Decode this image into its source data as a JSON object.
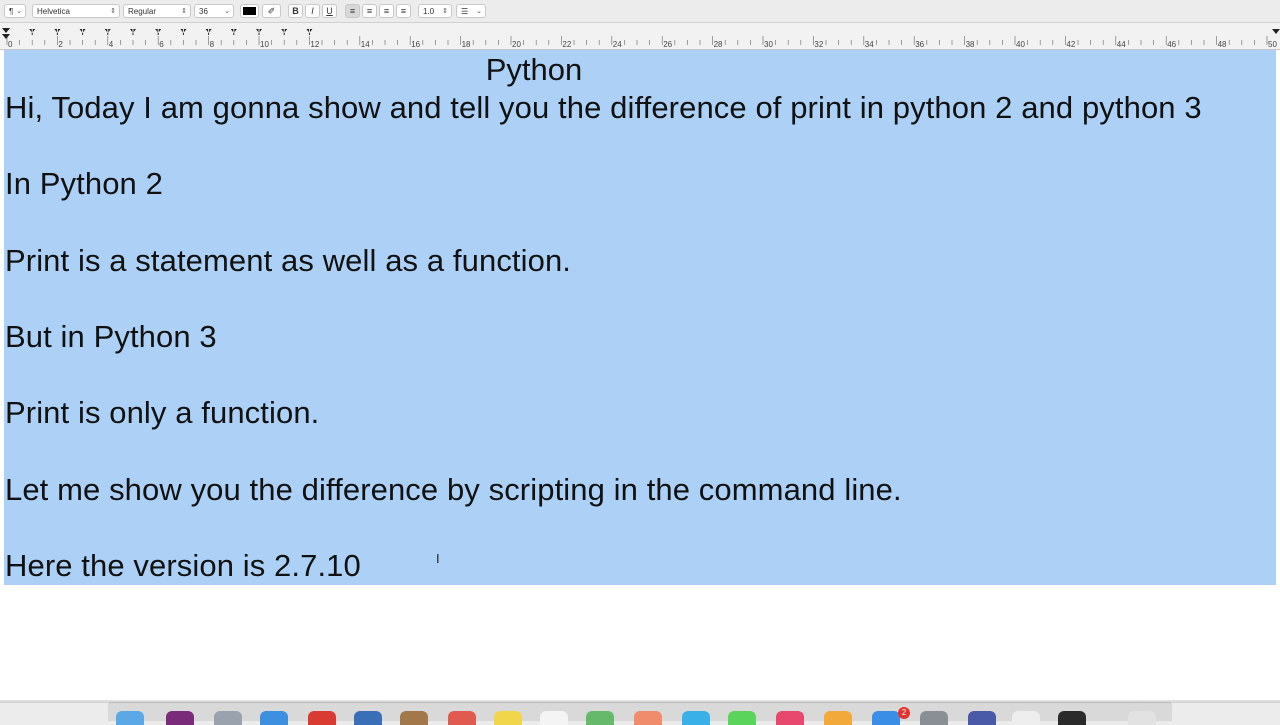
{
  "toolbar": {
    "paragraph_style": "¶",
    "font_family": "Helvetica",
    "font_style": "Regular",
    "font_size": "36",
    "bold": "B",
    "italic": "I",
    "underline": "U",
    "line_spacing": "1.0",
    "text_color": "#000000"
  },
  "ruler": {
    "labels": [
      "0",
      "2",
      "4",
      "6",
      "8",
      "10",
      "12",
      "14",
      "16",
      "18",
      "20",
      "22",
      "24",
      "26",
      "28",
      "30",
      "32",
      "34",
      "36",
      "38",
      "40",
      "42",
      "44",
      "46",
      "48",
      "50"
    ]
  },
  "document": {
    "title": "Python",
    "lines": [
      "Hi, Today I am gonna show and tell you the difference of print in python 2 and python 3",
      "In Python 2",
      "Print is a statement as well as a function.",
      "But in Python 3",
      "Print is only a function.",
      "Let me show you the difference by scripting in the command line.",
      "Here the version is 2.7.10"
    ],
    "selection_color": "#acd0f6"
  },
  "dock": {
    "badge_count": "2"
  }
}
